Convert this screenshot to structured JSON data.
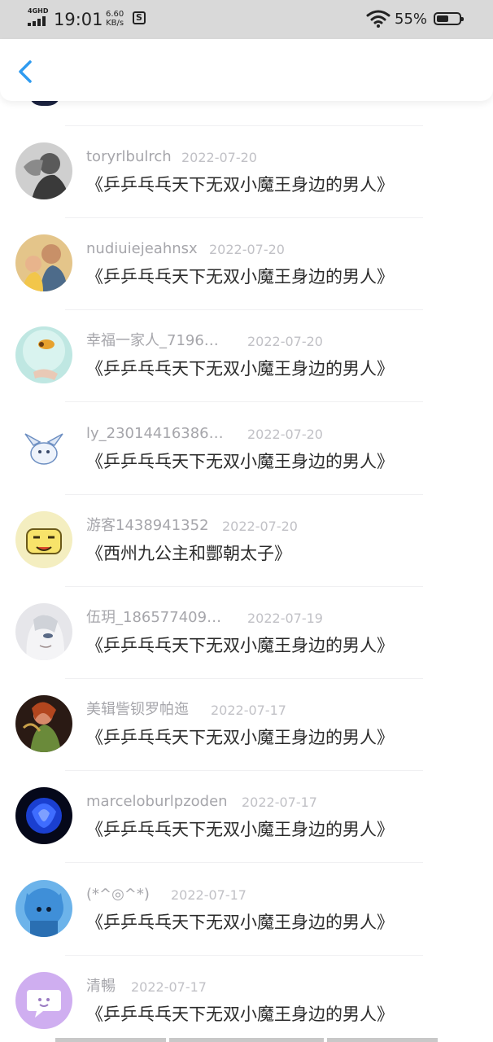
{
  "status_bar": {
    "network": "4GHD",
    "time": "19:01",
    "speed_value": "6.60",
    "speed_unit": "KB/s",
    "battery": "55%",
    "battery_level": 0.55
  },
  "header": {
    "back_icon": "chevron-left-icon",
    "accent_color": "#2f9bf0"
  },
  "items": [
    {
      "name": "toryrlbulrch",
      "date": "2022-07-20",
      "title": "《乒乒乓乓天下无双小魔王身边的男人》"
    },
    {
      "name": "nudiuiejeahnsx",
      "date": "2022-07-20",
      "title": "《乒乒乓乓天下无双小魔王身边的男人》"
    },
    {
      "name": "幸福一家人_7196…",
      "date": "2022-07-20",
      "title": "《乒乒乓乓天下无双小魔王身边的男人》"
    },
    {
      "name": "ly_23014416386…",
      "date": "2022-07-20",
      "title": "《乒乒乓乓天下无双小魔王身边的男人》"
    },
    {
      "name": "游客1438941352",
      "date": "2022-07-20",
      "title": "《西州九公主和酆朝太子》"
    },
    {
      "name": "伍玥_186577409…",
      "date": "2022-07-19",
      "title": "《乒乒乓乓天下无双小魔王身边的男人》"
    },
    {
      "name": "美辑訾钡罗帕迤",
      "date": "2022-07-17",
      "title": "《乒乒乓乓天下无双小魔王身边的男人》"
    },
    {
      "name": "marceloburlpzoden",
      "date": "2022-07-17",
      "title": "《乒乒乓乓天下无双小魔王身边的男人》"
    },
    {
      "name": "(*^◎^*)",
      "date": "2022-07-17",
      "title": "《乒乒乓乓天下无双小魔王身边的男人》"
    },
    {
      "name": "清暢",
      "date": "2022-07-17",
      "title": "《乒乒乓乓天下无双小魔王身边的男人》"
    }
  ]
}
